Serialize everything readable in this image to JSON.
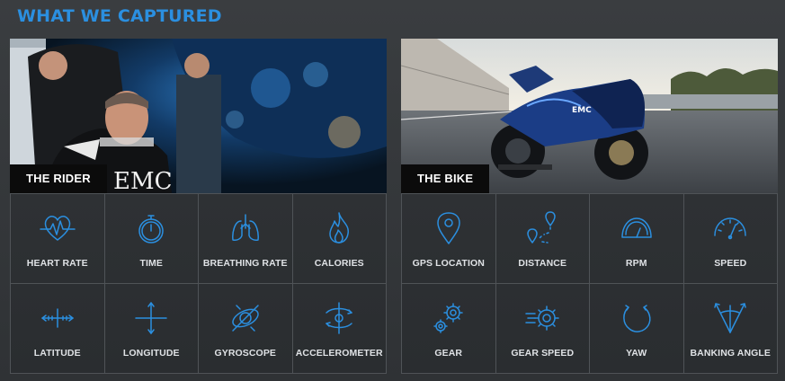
{
  "page": {
    "title": "WHAT WE CAPTURED"
  },
  "rider": {
    "label": "THE RIDER",
    "logo_text": "EMC",
    "metrics": [
      {
        "label": "HEART RATE",
        "icon": "heart-rate-icon"
      },
      {
        "label": "TIME",
        "icon": "stopwatch-icon"
      },
      {
        "label": "BREATHING RATE",
        "icon": "lungs-icon"
      },
      {
        "label": "CALORIES",
        "icon": "flame-icon"
      },
      {
        "label": "LATITUDE",
        "icon": "latitude-arrows-icon"
      },
      {
        "label": "LONGITUDE",
        "icon": "longitude-arrows-icon"
      },
      {
        "label": "GYROSCOPE",
        "icon": "gyroscope-icon"
      },
      {
        "label": "ACCELEROMETER",
        "icon": "accelerometer-icon"
      }
    ]
  },
  "bike": {
    "label": "THE BIKE",
    "logo_text": "EMC",
    "metrics": [
      {
        "label": "GPS LOCATION",
        "icon": "map-pin-icon"
      },
      {
        "label": "DISTANCE",
        "icon": "route-pins-icon"
      },
      {
        "label": "RPM",
        "icon": "tachometer-icon"
      },
      {
        "label": "SPEED",
        "icon": "speedometer-icon"
      },
      {
        "label": "GEAR",
        "icon": "gears-icon"
      },
      {
        "label": "GEAR SPEED",
        "icon": "gear-motion-icon"
      },
      {
        "label": "YAW",
        "icon": "yaw-arrow-icon"
      },
      {
        "label": "BANKING ANGLE",
        "icon": "banking-angle-icon"
      }
    ]
  },
  "colors": {
    "accent": "#2b8fe0",
    "background": "#33363a",
    "label_bg": "#0b0b0b"
  }
}
